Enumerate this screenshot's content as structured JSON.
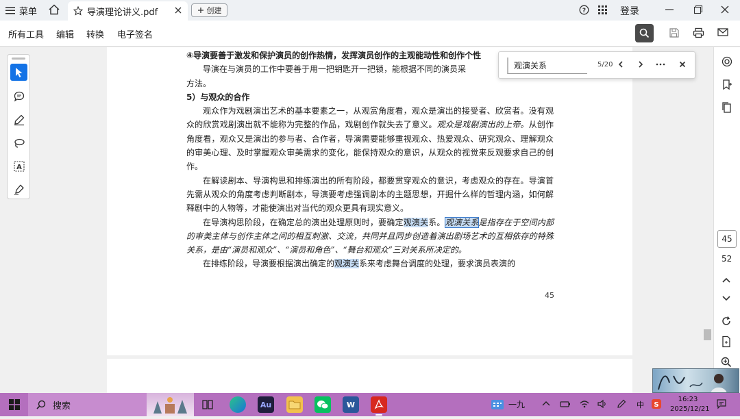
{
  "titlebar": {
    "menu_label": "菜单",
    "tab_title": "导演理论讲义.pdf",
    "create_label": "创建",
    "login_label": "登录"
  },
  "toolbar": {
    "all_tools": "所有工具",
    "edit": "编辑",
    "convert": "转换",
    "esign": "电子签名"
  },
  "document": {
    "lines": {
      "l1": "④导演要善于激发和保护演员的创作热情，发挥演员创作的主观能动性和创作个性",
      "l2": "导演在与演员的工作中要善于用一把钥匙开一把锁，能根据不同的演员采",
      "l3": "方法。",
      "h5": "5）与观众的合作",
      "p1": "观众作为戏剧演出艺术的基本要素之一，从观赏角度看，观众是演出的接受者、欣赏者。没有观众的欣赏戏剧演出就不能称为完整的作品，戏剧创作就失去了意义。",
      "p1_serif": "观众是戏剧演出的上帝。",
      "p1_rest": "从创作角度看，观众又是演出的参与者、合作者，导演需要能够重视观众、热爱观众、研究观众、理解观众的审美心理、及时掌握观众审美需求的变化，能保持观众的意识，从观众的视觉来反观要求自己的创作。",
      "p2": "在解读剧本、导演构思和排练演出的所有阶段，都要贯穿观众的意识，考虑观众的存在。导演首先需从观众的角度考虑判断剧本，导演要考虑强调剧本的主题思想，开掘什么样的哲理内涵，如何解释剧中的人物等，才能使演出对当代的观众更具有现实意义。",
      "p3_a": "在导演构思阶段，在确定总的演出处理原则时，要确定",
      "p3_hl1": "观演关",
      "p3_b": "系。",
      "p3_hl2": "观演关系",
      "p3_serif": "是指存在于空间内部的审美主体与创作主体之间的相互刺激、交流，共同并且同步创造着演出剧场艺术的互相依存的特殊关系，是由“演员和观众”、“演员和角色”、“舞台和观众”三对关系所决定的。",
      "p4_a": "在排练阶段，导演要根据演出确定的",
      "p4_hl": "观演关",
      "p4_b": "系来考虑舞台调度的处理，要求演员表演的"
    },
    "page_number": "45"
  },
  "find": {
    "query": "观演关系",
    "count": "5/20"
  },
  "navigation": {
    "current_page": "45",
    "total_pages": "52"
  },
  "taskbar": {
    "search_label": "搜索",
    "weather": "一九",
    "ime": "中",
    "time": "16:23",
    "date": "2025/12/21"
  },
  "colors": {
    "accent": "#1473e6",
    "highlight": "#c6dcf4",
    "taskbar": "#b46fbe"
  }
}
